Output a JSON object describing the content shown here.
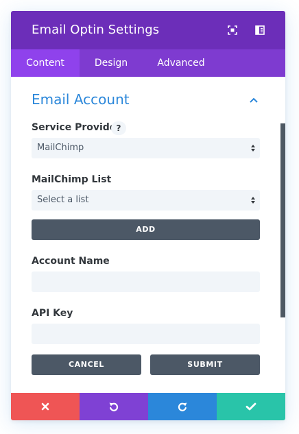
{
  "header": {
    "title": "Email Optin Settings",
    "icons": [
      "expand-icon",
      "sidebar-toggle-icon"
    ]
  },
  "tabs": [
    {
      "label": "Content",
      "active": true
    },
    {
      "label": "Design",
      "active": false
    },
    {
      "label": "Advanced",
      "active": false
    }
  ],
  "section": {
    "title": "Email Account",
    "expanded": true
  },
  "form": {
    "service_provider": {
      "label": "Service Provider",
      "help": "?",
      "value": "MailChimp"
    },
    "list": {
      "label": "MailChimp List",
      "value": "Select a list"
    },
    "add_label": "ADD",
    "account_name": {
      "label": "Account Name",
      "value": ""
    },
    "api_key": {
      "label": "API Key",
      "value": ""
    },
    "cancel_label": "CANCEL",
    "submit_label": "SUBMIT"
  },
  "footer": {
    "icons": [
      "close-icon",
      "undo-icon",
      "redo-icon",
      "check-icon"
    ]
  },
  "colors": {
    "header": "#6c2eb9",
    "tabs": "#7e3bd0",
    "tab_active": "#8f42ec",
    "accent": "#2b87da",
    "button": "#4c5866",
    "discard": "#ef5555",
    "undo": "#7f41d4",
    "redo": "#2b87da",
    "save": "#29c4a9"
  }
}
